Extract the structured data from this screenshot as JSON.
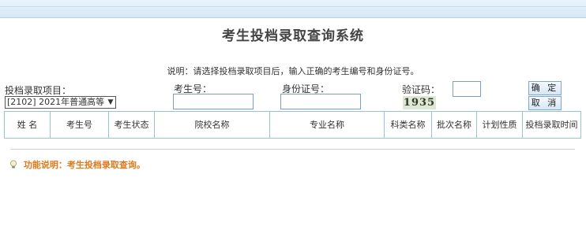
{
  "page": {
    "title": "考生投档录取查询系统"
  },
  "instruction": "说明：请选择投档录取项目后，输入正确的考生编号和身份证号。",
  "form": {
    "project_label": "投档录取项目：",
    "project_selected": "[2102] 2021年普通高等",
    "exam_no_label": "考生号：",
    "exam_no_value": "",
    "id_no_label": "身份证号：",
    "id_no_value": "",
    "captcha_label": "验证码：",
    "captcha_value": "",
    "captcha_image_text": "1935",
    "confirm_label": "确 定",
    "cancel_label": "取 消"
  },
  "table": {
    "headers": [
      "姓 名",
      "考生号",
      "考生状态",
      "院校名称",
      "专业名称",
      "科类名称",
      "批次名称",
      "计划性质",
      "投档录取时间"
    ]
  },
  "footer": {
    "note": "功能说明：考生投档录取查询。"
  },
  "colors": {
    "accent": "#e0791c",
    "table_border": "#93c2e8"
  }
}
